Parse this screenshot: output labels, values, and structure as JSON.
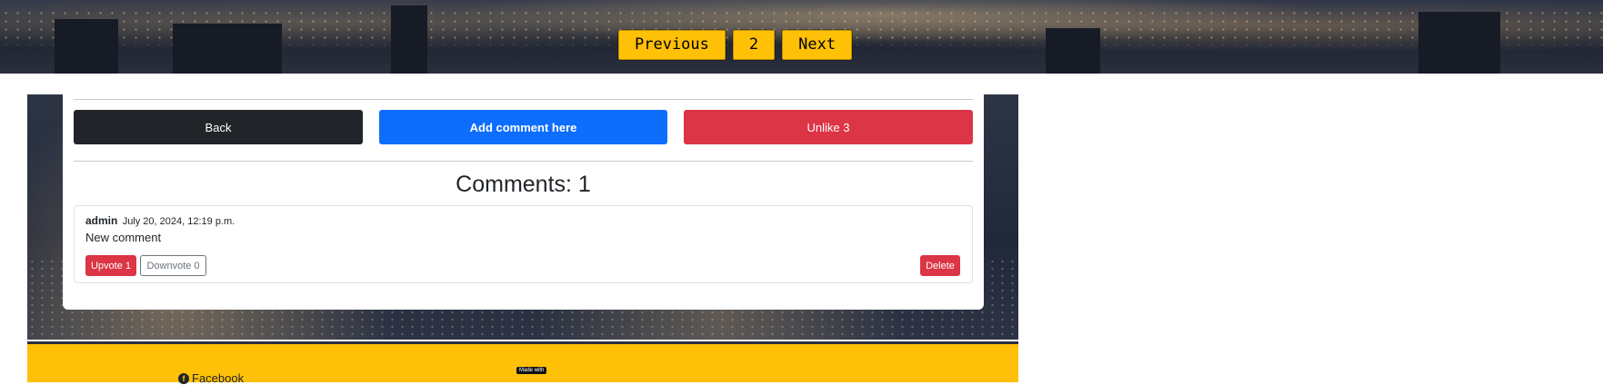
{
  "pagination": {
    "previous_label": "Previous",
    "current_page": "2",
    "next_label": "Next"
  },
  "actions": {
    "back_label": "Back",
    "add_comment_label": "Add comment here",
    "unlike_label": "Unlike 3"
  },
  "comments": {
    "title": "Comments: 1",
    "items": [
      {
        "author": "admin",
        "date": "July 20, 2024, 12:19 p.m.",
        "text": "New comment",
        "upvote_label": "Upvote 1",
        "downvote_label": "Downvote 0",
        "delete_label": "Delete"
      }
    ]
  },
  "footer": {
    "facebook_label": "Facebook",
    "badge_text": "Made with"
  },
  "colors": {
    "accent_yellow": "#ffc107",
    "primary_blue": "#0d6efd",
    "danger_red": "#dc3545",
    "dark": "#212529"
  },
  "icons": {
    "facebook": "facebook-icon"
  }
}
